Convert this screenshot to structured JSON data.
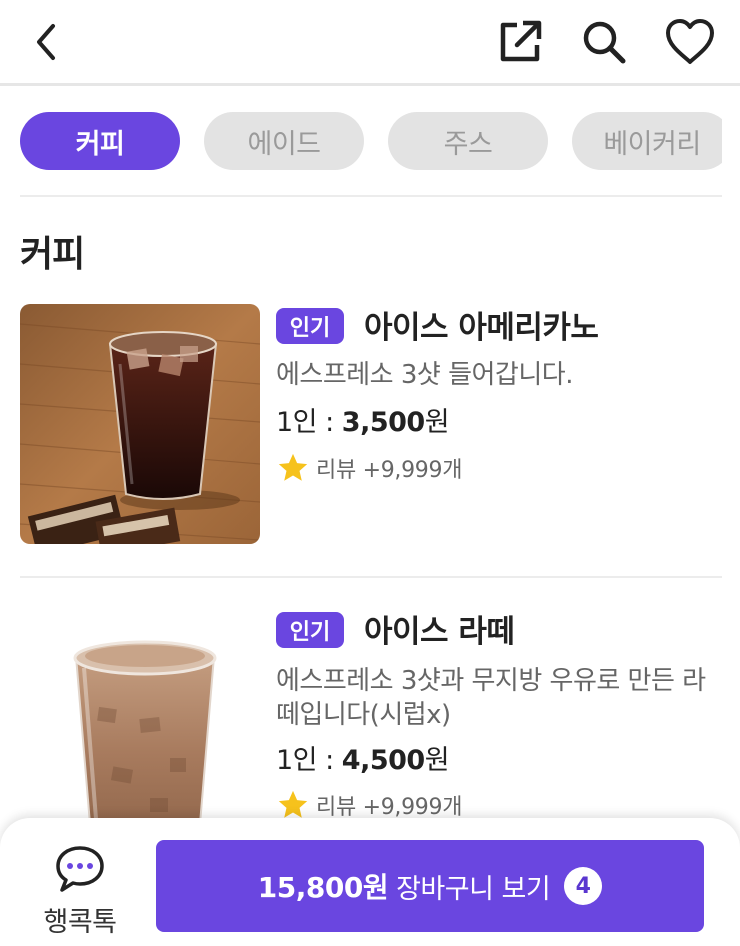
{
  "header": {
    "back_icon": "chevron-left-icon",
    "share_icon": "external-link-icon",
    "search_icon": "search-icon",
    "favorite_icon": "heart-icon"
  },
  "tabs": [
    {
      "label": "커피",
      "active": true
    },
    {
      "label": "에이드",
      "active": false
    },
    {
      "label": "주스",
      "active": false
    },
    {
      "label": "베이커리",
      "active": false
    }
  ],
  "section_title": "커피",
  "products": [
    {
      "badge": "인기",
      "name": "아이스 아메리카노",
      "description": "에스프레소 3샷 들어갑니다.",
      "price_prefix": "1인 : ",
      "price_value": "3,500",
      "price_unit": "원",
      "review": "리뷰 +9,999개"
    },
    {
      "badge": "인기",
      "name": "아이스 라떼",
      "description": "에스프레소 3샷과 무지방 우유로 만든 라떼입니다(시럽x)",
      "price_prefix": "1인 : ",
      "price_value": "4,500",
      "price_unit": "원",
      "review": "리뷰 +9,999개"
    }
  ],
  "bottom": {
    "chat_label": "행콕톡",
    "cart_price": "15,800원",
    "cart_label": "장바구니 보기",
    "cart_count": "4"
  },
  "colors": {
    "accent": "#6a46e0",
    "star": "#f6c21c"
  }
}
